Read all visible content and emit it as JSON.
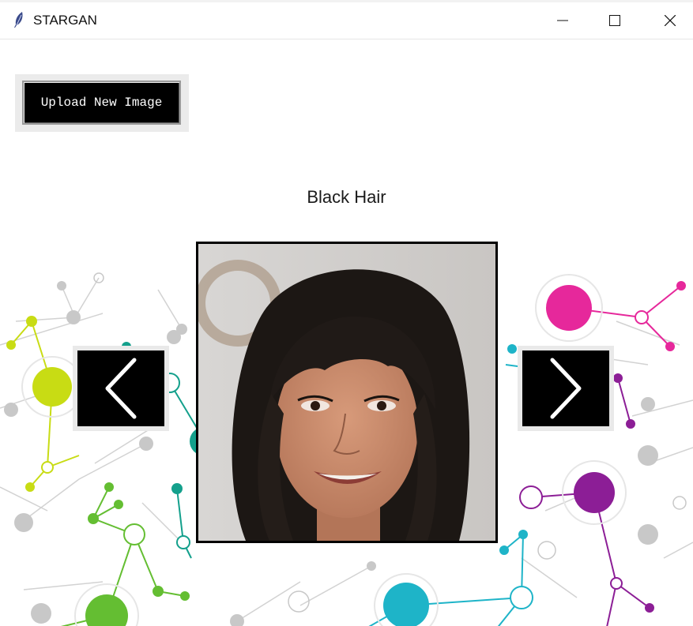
{
  "window": {
    "title": "STARGAN",
    "icon": "feather-icon",
    "controls": [
      "minimize-icon",
      "maximize-icon",
      "close-icon"
    ]
  },
  "toolbar": {
    "upload_label": "Upload New Image"
  },
  "viewer": {
    "attribute_label": "Black Hair",
    "prev_icon": "chevron-left-icon",
    "next_icon": "chevron-right-icon",
    "image_subject": "face-portrait"
  },
  "colors": {
    "button_bg": "#000000",
    "node_lime": "#c8dc14",
    "node_green": "#64be32",
    "node_teal": "#14a08c",
    "node_cyan": "#1eb4c8",
    "node_magenta": "#e6289b",
    "node_purple": "#8c1e96",
    "node_gray": "#c8c8c8"
  }
}
